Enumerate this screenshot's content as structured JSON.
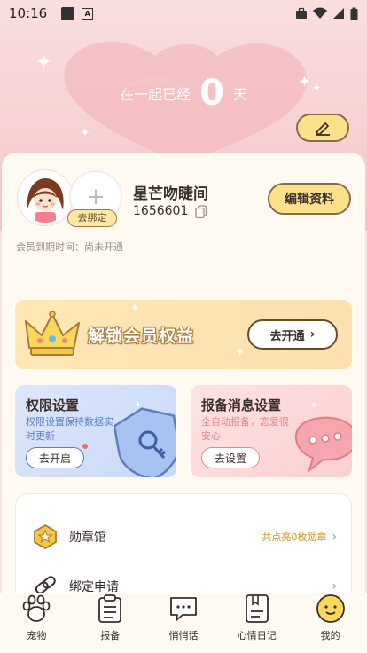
{
  "status_bar": {
    "time": "10:16"
  },
  "header": {
    "together_prefix": "在一起已经",
    "together_days": "0",
    "together_suffix": "天"
  },
  "profile": {
    "nickname": "星芒吻睫间",
    "user_id": "1656601",
    "bind_label": "去绑定",
    "edit_profile_label": "编辑资料",
    "member_expiry": "会员到期时间：尚未开通"
  },
  "vip_banner": {
    "text": "解锁会员权益",
    "button_label": "去开通"
  },
  "features": [
    {
      "title": "权限设置",
      "desc": "权限设置保持数据实时更新",
      "button": "去开启"
    },
    {
      "title": "报备消息设置",
      "desc": "全自动报备，恋爱很安心",
      "button": "去设置"
    }
  ],
  "list": [
    {
      "label": "勋章馆",
      "right": "共点亮0枚勋章"
    },
    {
      "label": "绑定申请",
      "right": ""
    }
  ],
  "tabs": [
    {
      "label": "宠物",
      "icon": "paw-icon"
    },
    {
      "label": "报备",
      "icon": "clipboard-icon"
    },
    {
      "label": "悄悄话",
      "icon": "chat-icon"
    },
    {
      "label": "心情日记",
      "icon": "diary-icon"
    },
    {
      "label": "我的",
      "icon": "smile-face-icon"
    }
  ],
  "colors": {
    "accent_yellow": "#fbe08a",
    "brown_outline": "#8a6a4a",
    "pink_bg": "#f7d0d2",
    "blue_card": "#c8d8f6",
    "pink_card": "#fbd0d2"
  }
}
